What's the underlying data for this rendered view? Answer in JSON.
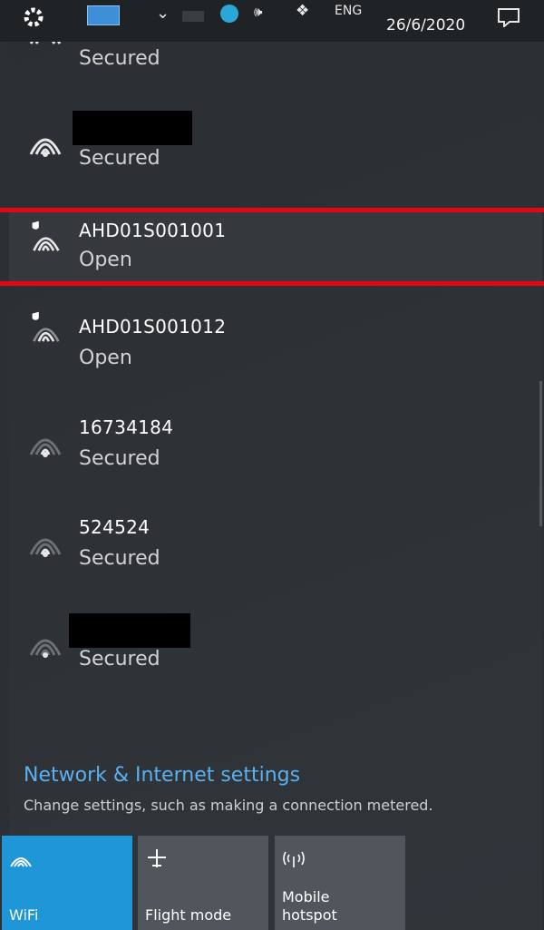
{
  "taskbar": {
    "language": "ENG",
    "date": "26/6/2020"
  },
  "networks": [
    {
      "name": "",
      "status": "Secured",
      "redacted": false,
      "partial": true
    },
    {
      "name": "",
      "status": "Secured",
      "redacted": true
    },
    {
      "name": "AHD01S001001",
      "status": "Open",
      "shield": true,
      "selected": true
    },
    {
      "name": "AHD01S001012",
      "status": "Open",
      "shield": true
    },
    {
      "name": "16734184",
      "status": "Secured"
    },
    {
      "name": "524524",
      "status": "Secured"
    },
    {
      "name": "",
      "status": "Secured",
      "redacted": true
    }
  ],
  "settings": {
    "title": "Network & Internet settings",
    "subtitle": "Change settings, such as making a connection metered."
  },
  "tiles": [
    {
      "label": "WiFi",
      "icon": "wifi-icon",
      "active": true
    },
    {
      "label": "Flight mode",
      "icon": "airplane-icon",
      "active": false
    },
    {
      "label": "Mobile\nhotspot",
      "icon": "hotspot-icon",
      "active": false
    }
  ],
  "colors": {
    "accent": "#1f96d8",
    "highlight": "#e30613",
    "link": "#5ab0f0"
  }
}
